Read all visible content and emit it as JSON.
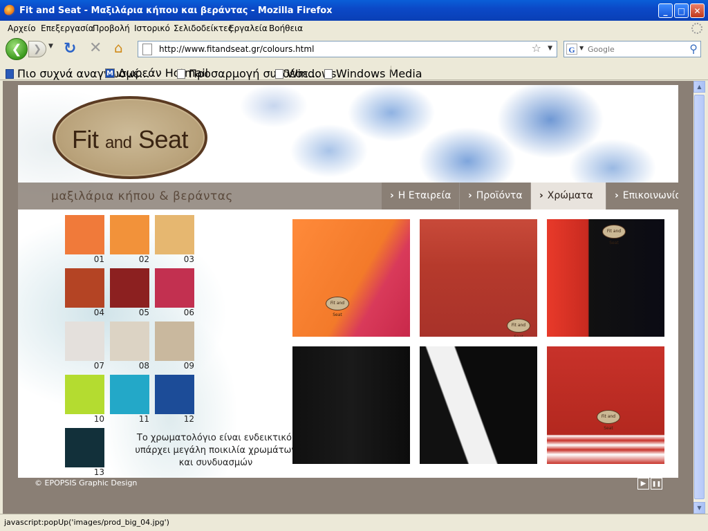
{
  "window": {
    "title": "Fit and Seat - Μαξιλάρια κήπου και βεράντας - Mozilla Firefox",
    "minimize": "_",
    "maximize": "□",
    "close": "✕"
  },
  "menu": [
    "Αρχείο",
    "Επεξεργασία",
    "Προβολή",
    "Ιστορικό",
    "Σελιδοδείκτες",
    "Εργαλεία",
    "Βοήθεια"
  ],
  "toolbar": {
    "back": "❮",
    "forward": "❯",
    "url": "http://www.fitandseat.gr/colours.html",
    "search_placeholder": "Google"
  },
  "bookmarks": [
    "Πιο συχνά αναγνωσμέ...",
    "Δωρεάν Hotmail",
    "Προσαρμογή συνδέσε...",
    "Windows",
    "Windows Media"
  ],
  "site": {
    "logo_text": {
      "fit": "Fit ",
      "and": "and",
      "seat": " Seat"
    },
    "tagline": "μαξιλάρια κήπου & βεράντας",
    "nav": [
      {
        "label": "Η Εταιρεία",
        "active": false
      },
      {
        "label": "Προϊόντα",
        "active": false
      },
      {
        "label": "Χρώματα",
        "active": true
      },
      {
        "label": "Επικοινωνία",
        "active": false
      }
    ],
    "swatches": [
      {
        "num": "01",
        "color": "#f07a3a"
      },
      {
        "num": "02",
        "color": "#f2923a"
      },
      {
        "num": "03",
        "color": "#e6b770"
      },
      {
        "num": "04",
        "color": "#b44424"
      },
      {
        "num": "05",
        "color": "#8c2020"
      },
      {
        "num": "06",
        "color": "#c23050"
      },
      {
        "num": "07",
        "color": "#e4e0dc"
      },
      {
        "num": "08",
        "color": "#dcd3c4"
      },
      {
        "num": "09",
        "color": "#c9b89e"
      },
      {
        "num": "10",
        "color": "#b4dc30"
      },
      {
        "num": "11",
        "color": "#23a8c8"
      },
      {
        "num": "12",
        "color": "#1c4c98"
      },
      {
        "num": "13",
        "color": "#12303a"
      }
    ],
    "note": "Το χρωματολόγιο είναι ενδεικτικό, υπάρχει μεγάλη ποικιλία χρωμάτων και συνδυασμών",
    "photo_tag": "Fit and Seat",
    "copyright": "© EPOPSIS Graphic Design",
    "controls": {
      "play": "▶",
      "pause": "❚❚"
    }
  },
  "statusbar": "javascript:popUp('images/prod_big_04.jpg')"
}
